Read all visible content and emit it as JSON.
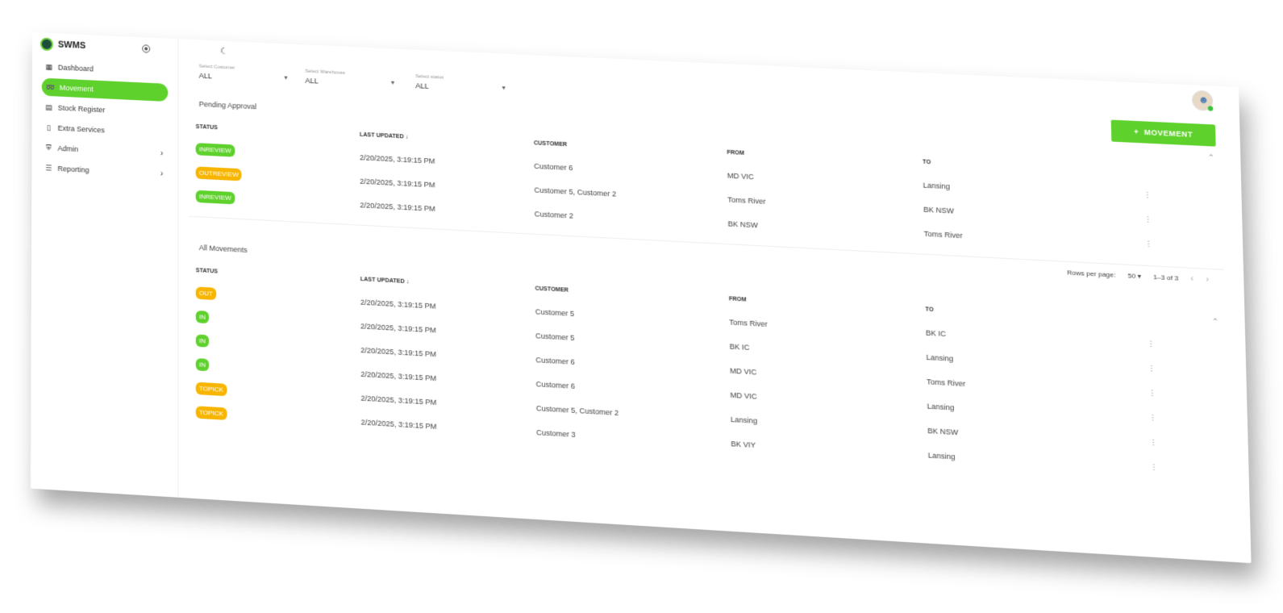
{
  "app": {
    "title": "SWMS"
  },
  "sidebar": {
    "items": [
      {
        "label": "Dashboard",
        "icon": "dashboard-icon",
        "active": false
      },
      {
        "label": "Movement",
        "icon": "movement-icon",
        "active": true
      },
      {
        "label": "Stock Register",
        "icon": "chart-icon",
        "active": false
      },
      {
        "label": "Extra Services",
        "icon": "document-icon",
        "active": false
      },
      {
        "label": "Admin",
        "icon": "shield-icon",
        "active": false,
        "expandable": true
      },
      {
        "label": "Reporting",
        "icon": "report-icon",
        "active": false,
        "expandable": true
      }
    ]
  },
  "filters": {
    "customer": {
      "label": "Select Customer",
      "value": "ALL"
    },
    "warehouse": {
      "label": "Select Warehouse",
      "value": "ALL"
    },
    "status": {
      "label": "Select status",
      "value": "ALL"
    }
  },
  "add_button": {
    "label": "MOVEMENT"
  },
  "columns": {
    "status": "STATUS",
    "last_updated": "LAST UPDATED",
    "customer": "CUSTOMER",
    "from": "FROM",
    "to": "TO"
  },
  "pending": {
    "title": "Pending Approval",
    "rows": [
      {
        "status": "INREVIEW",
        "color": "green",
        "updated": "2/20/2025, 3:19:15 PM",
        "customer": "Customer 6",
        "from": "MD VIC",
        "to": "Lansing"
      },
      {
        "status": "OUTREVIEW",
        "color": "orange",
        "updated": "2/20/2025, 3:19:15 PM",
        "customer": "Customer 5, Customer 2",
        "from": "Toms River",
        "to": "BK NSW"
      },
      {
        "status": "INREVIEW",
        "color": "green",
        "updated": "2/20/2025, 3:19:15 PM",
        "customer": "Customer 2",
        "from": "BK NSW",
        "to": "Toms River"
      }
    ],
    "pager": {
      "rows_label": "Rows per page:",
      "rows_value": "50",
      "range": "1–3 of 3"
    }
  },
  "all": {
    "title": "All Movements",
    "rows": [
      {
        "status": "OUT",
        "color": "orange",
        "updated": "2/20/2025, 3:19:15 PM",
        "customer": "Customer 5",
        "from": "Toms River",
        "to": "BK IC"
      },
      {
        "status": "IN",
        "color": "green",
        "updated": "2/20/2025, 3:19:15 PM",
        "customer": "Customer 5",
        "from": "BK IC",
        "to": "Lansing"
      },
      {
        "status": "IN",
        "color": "green",
        "updated": "2/20/2025, 3:19:15 PM",
        "customer": "Customer 6",
        "from": "MD VIC",
        "to": "Toms River"
      },
      {
        "status": "IN",
        "color": "green",
        "updated": "2/20/2025, 3:19:15 PM",
        "customer": "Customer 6",
        "from": "MD VIC",
        "to": "Lansing"
      },
      {
        "status": "TOPICK",
        "color": "orange",
        "updated": "2/20/2025, 3:19:15 PM",
        "customer": "Customer 5, Customer 2",
        "from": "Lansing",
        "to": "BK NSW"
      },
      {
        "status": "TOPICK",
        "color": "orange",
        "updated": "2/20/2025, 3:19:15 PM",
        "customer": "Customer 3",
        "from": "BK VIY",
        "to": "Lansing"
      }
    ]
  },
  "colors": {
    "accent": "#5fd12d",
    "warning": "#f7b500"
  }
}
